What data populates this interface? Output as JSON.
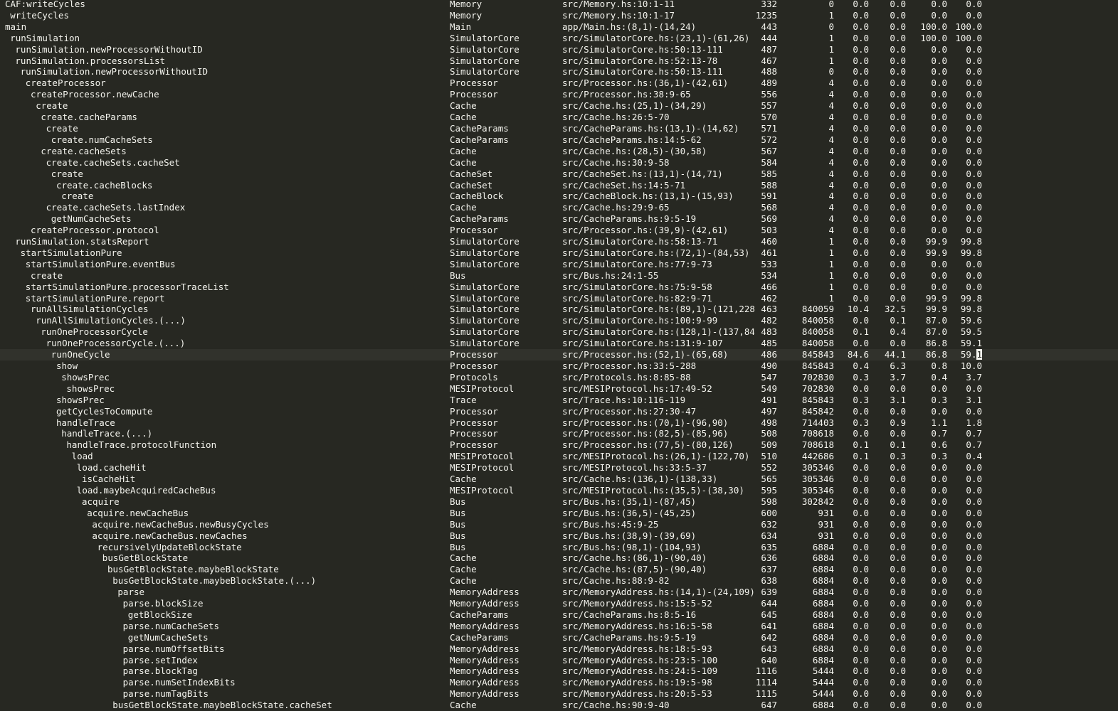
{
  "cursor_row": 31,
  "rows": [
    {
      "name": "CAF:writeCycles",
      "indent": 0,
      "module": "Memory",
      "src": "src/Memory.hs:10:1-11",
      "no": "332",
      "entries": "0",
      "ind_time": "0.0",
      "ind_alloc": "0.0",
      "inh_time": "0.0",
      "inh_alloc": "0.0"
    },
    {
      "name": "writeCycles",
      "indent": 1,
      "module": "Memory",
      "src": "src/Memory.hs:10:1-17",
      "no": "1235",
      "entries": "1",
      "ind_time": "0.0",
      "ind_alloc": "0.0",
      "inh_time": "0.0",
      "inh_alloc": "0.0"
    },
    {
      "name": "main",
      "indent": 0,
      "module": "Main",
      "src": "app/Main.hs:(8,1)-(14,24)",
      "no": "443",
      "entries": "0",
      "ind_time": "0.0",
      "ind_alloc": "0.0",
      "inh_time": "100.0",
      "inh_alloc": "100.0"
    },
    {
      "name": "runSimulation",
      "indent": 1,
      "module": "SimulatorCore",
      "src": "src/SimulatorCore.hs:(23,1)-(61,26)",
      "no": "444",
      "entries": "1",
      "ind_time": "0.0",
      "ind_alloc": "0.0",
      "inh_time": "100.0",
      "inh_alloc": "100.0"
    },
    {
      "name": "runSimulation.newProcessorWithoutID",
      "indent": 2,
      "module": "SimulatorCore",
      "src": "src/SimulatorCore.hs:50:13-111",
      "no": "487",
      "entries": "1",
      "ind_time": "0.0",
      "ind_alloc": "0.0",
      "inh_time": "0.0",
      "inh_alloc": "0.0"
    },
    {
      "name": "runSimulation.processorsList",
      "indent": 2,
      "module": "SimulatorCore",
      "src": "src/SimulatorCore.hs:52:13-78",
      "no": "467",
      "entries": "1",
      "ind_time": "0.0",
      "ind_alloc": "0.0",
      "inh_time": "0.0",
      "inh_alloc": "0.0"
    },
    {
      "name": "runSimulation.newProcessorWithoutID",
      "indent": 3,
      "module": "SimulatorCore",
      "src": "src/SimulatorCore.hs:50:13-111",
      "no": "488",
      "entries": "0",
      "ind_time": "0.0",
      "ind_alloc": "0.0",
      "inh_time": "0.0",
      "inh_alloc": "0.0"
    },
    {
      "name": "createProcessor",
      "indent": 4,
      "module": "Processor",
      "src": "src/Processor.hs:(36,1)-(42,61)",
      "no": "489",
      "entries": "4",
      "ind_time": "0.0",
      "ind_alloc": "0.0",
      "inh_time": "0.0",
      "inh_alloc": "0.0"
    },
    {
      "name": "createProcessor.newCache",
      "indent": 5,
      "module": "Processor",
      "src": "src/Processor.hs:38:9-65",
      "no": "556",
      "entries": "4",
      "ind_time": "0.0",
      "ind_alloc": "0.0",
      "inh_time": "0.0",
      "inh_alloc": "0.0"
    },
    {
      "name": "create",
      "indent": 6,
      "module": "Cache",
      "src": "src/Cache.hs:(25,1)-(34,29)",
      "no": "557",
      "entries": "4",
      "ind_time": "0.0",
      "ind_alloc": "0.0",
      "inh_time": "0.0",
      "inh_alloc": "0.0"
    },
    {
      "name": "create.cacheParams",
      "indent": 7,
      "module": "Cache",
      "src": "src/Cache.hs:26:5-70",
      "no": "570",
      "entries": "4",
      "ind_time": "0.0",
      "ind_alloc": "0.0",
      "inh_time": "0.0",
      "inh_alloc": "0.0"
    },
    {
      "name": "create",
      "indent": 8,
      "module": "CacheParams",
      "src": "src/CacheParams.hs:(13,1)-(14,62)",
      "no": "571",
      "entries": "4",
      "ind_time": "0.0",
      "ind_alloc": "0.0",
      "inh_time": "0.0",
      "inh_alloc": "0.0"
    },
    {
      "name": "create.numCacheSets",
      "indent": 9,
      "module": "CacheParams",
      "src": "src/CacheParams.hs:14:5-62",
      "no": "572",
      "entries": "4",
      "ind_time": "0.0",
      "ind_alloc": "0.0",
      "inh_time": "0.0",
      "inh_alloc": "0.0"
    },
    {
      "name": "create.cacheSets",
      "indent": 7,
      "module": "Cache",
      "src": "src/Cache.hs:(28,5)-(30,58)",
      "no": "567",
      "entries": "4",
      "ind_time": "0.0",
      "ind_alloc": "0.0",
      "inh_time": "0.0",
      "inh_alloc": "0.0"
    },
    {
      "name": "create.cacheSets.cacheSet",
      "indent": 8,
      "module": "Cache",
      "src": "src/Cache.hs:30:9-58",
      "no": "584",
      "entries": "4",
      "ind_time": "0.0",
      "ind_alloc": "0.0",
      "inh_time": "0.0",
      "inh_alloc": "0.0"
    },
    {
      "name": "create",
      "indent": 9,
      "module": "CacheSet",
      "src": "src/CacheSet.hs:(13,1)-(14,71)",
      "no": "585",
      "entries": "4",
      "ind_time": "0.0",
      "ind_alloc": "0.0",
      "inh_time": "0.0",
      "inh_alloc": "0.0"
    },
    {
      "name": "create.cacheBlocks",
      "indent": 10,
      "module": "CacheSet",
      "src": "src/CacheSet.hs:14:5-71",
      "no": "588",
      "entries": "4",
      "ind_time": "0.0",
      "ind_alloc": "0.0",
      "inh_time": "0.0",
      "inh_alloc": "0.0"
    },
    {
      "name": "create",
      "indent": 11,
      "module": "CacheBlock",
      "src": "src/CacheBlock.hs:(13,1)-(15,93)",
      "no": "591",
      "entries": "4",
      "ind_time": "0.0",
      "ind_alloc": "0.0",
      "inh_time": "0.0",
      "inh_alloc": "0.0"
    },
    {
      "name": "create.cacheSets.lastIndex",
      "indent": 8,
      "module": "Cache",
      "src": "src/Cache.hs:29:9-65",
      "no": "568",
      "entries": "4",
      "ind_time": "0.0",
      "ind_alloc": "0.0",
      "inh_time": "0.0",
      "inh_alloc": "0.0"
    },
    {
      "name": "getNumCacheSets",
      "indent": 9,
      "module": "CacheParams",
      "src": "src/CacheParams.hs:9:5-19",
      "no": "569",
      "entries": "4",
      "ind_time": "0.0",
      "ind_alloc": "0.0",
      "inh_time": "0.0",
      "inh_alloc": "0.0"
    },
    {
      "name": "createProcessor.protocol",
      "indent": 5,
      "module": "Processor",
      "src": "src/Processor.hs:(39,9)-(42,61)",
      "no": "503",
      "entries": "4",
      "ind_time": "0.0",
      "ind_alloc": "0.0",
      "inh_time": "0.0",
      "inh_alloc": "0.0"
    },
    {
      "name": "runSimulation.statsReport",
      "indent": 2,
      "module": "SimulatorCore",
      "src": "src/SimulatorCore.hs:58:13-71",
      "no": "460",
      "entries": "1",
      "ind_time": "0.0",
      "ind_alloc": "0.0",
      "inh_time": "99.9",
      "inh_alloc": "99.8"
    },
    {
      "name": "startSimulationPure",
      "indent": 3,
      "module": "SimulatorCore",
      "src": "src/SimulatorCore.hs:(72,1)-(84,53)",
      "no": "461",
      "entries": "1",
      "ind_time": "0.0",
      "ind_alloc": "0.0",
      "inh_time": "99.9",
      "inh_alloc": "99.8"
    },
    {
      "name": "startSimulationPure.eventBus",
      "indent": 4,
      "module": "SimulatorCore",
      "src": "src/SimulatorCore.hs:77:9-73",
      "no": "533",
      "entries": "1",
      "ind_time": "0.0",
      "ind_alloc": "0.0",
      "inh_time": "0.0",
      "inh_alloc": "0.0"
    },
    {
      "name": "create",
      "indent": 5,
      "module": "Bus",
      "src": "src/Bus.hs:24:1-55",
      "no": "534",
      "entries": "1",
      "ind_time": "0.0",
      "ind_alloc": "0.0",
      "inh_time": "0.0",
      "inh_alloc": "0.0"
    },
    {
      "name": "startSimulationPure.processorTraceList",
      "indent": 4,
      "module": "SimulatorCore",
      "src": "src/SimulatorCore.hs:75:9-58",
      "no": "466",
      "entries": "1",
      "ind_time": "0.0",
      "ind_alloc": "0.0",
      "inh_time": "0.0",
      "inh_alloc": "0.0"
    },
    {
      "name": "startSimulationPure.report",
      "indent": 4,
      "module": "SimulatorCore",
      "src": "src/SimulatorCore.hs:82:9-71",
      "no": "462",
      "entries": "1",
      "ind_time": "0.0",
      "ind_alloc": "0.0",
      "inh_time": "99.9",
      "inh_alloc": "99.8"
    },
    {
      "name": "runAllSimulationCycles",
      "indent": 5,
      "module": "SimulatorCore",
      "src": "src/SimulatorCore.hs:(89,1)-(121,228)",
      "no": "463",
      "entries": "840059",
      "ind_time": "10.4",
      "ind_alloc": "32.5",
      "inh_time": "99.9",
      "inh_alloc": "99.8"
    },
    {
      "name": "runAllSimulationCycles.(...)",
      "indent": 6,
      "module": "SimulatorCore",
      "src": "src/SimulatorCore.hs:100:9-99",
      "no": "482",
      "entries": "840058",
      "ind_time": "0.0",
      "ind_alloc": "0.1",
      "inh_time": "87.0",
      "inh_alloc": "59.6"
    },
    {
      "name": "runOneProcessorCycle",
      "indent": 7,
      "module": "SimulatorCore",
      "src": "src/SimulatorCore.hs:(128,1)-(137,84)",
      "no": "483",
      "entries": "840058",
      "ind_time": "0.1",
      "ind_alloc": "0.4",
      "inh_time": "87.0",
      "inh_alloc": "59.5"
    },
    {
      "name": "runOneProcessorCycle.(...)",
      "indent": 8,
      "module": "SimulatorCore",
      "src": "src/SimulatorCore.hs:131:9-107",
      "no": "485",
      "entries": "840058",
      "ind_time": "0.0",
      "ind_alloc": "0.0",
      "inh_time": "86.8",
      "inh_alloc": "59.1"
    },
    {
      "name": "runOneCycle",
      "indent": 9,
      "module": "Processor",
      "src": "src/Processor.hs:(52,1)-(65,68)",
      "no": "486",
      "entries": "845843",
      "ind_time": "84.6",
      "ind_alloc": "44.1",
      "inh_time": "86.8",
      "inh_alloc": "59.1"
    },
    {
      "name": "show",
      "indent": 10,
      "module": "Processor",
      "src": "src/Processor.hs:33:5-288",
      "no": "490",
      "entries": "845843",
      "ind_time": "0.4",
      "ind_alloc": "6.3",
      "inh_time": "0.8",
      "inh_alloc": "10.0"
    },
    {
      "name": "showsPrec",
      "indent": 11,
      "module": "Protocols",
      "src": "src/Protocols.hs:8:85-88",
      "no": "547",
      "entries": "702830",
      "ind_time": "0.3",
      "ind_alloc": "3.7",
      "inh_time": "0.4",
      "inh_alloc": "3.7"
    },
    {
      "name": "showsPrec",
      "indent": 12,
      "module": "MESIProtocol",
      "src": "src/MESIProtocol.hs:17:49-52",
      "no": "549",
      "entries": "702830",
      "ind_time": "0.0",
      "ind_alloc": "0.0",
      "inh_time": "0.0",
      "inh_alloc": "0.0"
    },
    {
      "name": "showsPrec",
      "indent": 10,
      "module": "Trace",
      "src": "src/Trace.hs:10:116-119",
      "no": "491",
      "entries": "845843",
      "ind_time": "0.3",
      "ind_alloc": "3.1",
      "inh_time": "0.3",
      "inh_alloc": "3.1"
    },
    {
      "name": "getCyclesToCompute",
      "indent": 10,
      "module": "Processor",
      "src": "src/Processor.hs:27:30-47",
      "no": "497",
      "entries": "845842",
      "ind_time": "0.0",
      "ind_alloc": "0.0",
      "inh_time": "0.0",
      "inh_alloc": "0.0"
    },
    {
      "name": "handleTrace",
      "indent": 10,
      "module": "Processor",
      "src": "src/Processor.hs:(70,1)-(96,90)",
      "no": "498",
      "entries": "714403",
      "ind_time": "0.3",
      "ind_alloc": "0.9",
      "inh_time": "1.1",
      "inh_alloc": "1.8"
    },
    {
      "name": "handleTrace.(...)",
      "indent": 11,
      "module": "Processor",
      "src": "src/Processor.hs:(82,5)-(85,96)",
      "no": "508",
      "entries": "708618",
      "ind_time": "0.0",
      "ind_alloc": "0.0",
      "inh_time": "0.7",
      "inh_alloc": "0.7"
    },
    {
      "name": "handleTrace.protocolFunction",
      "indent": 12,
      "module": "Processor",
      "src": "src/Processor.hs:(77,5)-(80,126)",
      "no": "509",
      "entries": "708618",
      "ind_time": "0.1",
      "ind_alloc": "0.1",
      "inh_time": "0.6",
      "inh_alloc": "0.7"
    },
    {
      "name": "load",
      "indent": 13,
      "module": "MESIProtocol",
      "src": "src/MESIProtocol.hs:(26,1)-(122,70)",
      "no": "510",
      "entries": "442686",
      "ind_time": "0.1",
      "ind_alloc": "0.3",
      "inh_time": "0.3",
      "inh_alloc": "0.4"
    },
    {
      "name": "load.cacheHit",
      "indent": 14,
      "module": "MESIProtocol",
      "src": "src/MESIProtocol.hs:33:5-37",
      "no": "552",
      "entries": "305346",
      "ind_time": "0.0",
      "ind_alloc": "0.0",
      "inh_time": "0.0",
      "inh_alloc": "0.0"
    },
    {
      "name": "isCacheHit",
      "indent": 15,
      "module": "Cache",
      "src": "src/Cache.hs:(136,1)-(138,33)",
      "no": "565",
      "entries": "305346",
      "ind_time": "0.0",
      "ind_alloc": "0.0",
      "inh_time": "0.0",
      "inh_alloc": "0.0"
    },
    {
      "name": "load.maybeAcquiredCacheBus",
      "indent": 14,
      "module": "MESIProtocol",
      "src": "src/MESIProtocol.hs:(35,5)-(38,30)",
      "no": "595",
      "entries": "305346",
      "ind_time": "0.0",
      "ind_alloc": "0.0",
      "inh_time": "0.0",
      "inh_alloc": "0.0"
    },
    {
      "name": "acquire",
      "indent": 15,
      "module": "Bus",
      "src": "src/Bus.hs:(35,1)-(87,45)",
      "no": "598",
      "entries": "302842",
      "ind_time": "0.0",
      "ind_alloc": "0.0",
      "inh_time": "0.0",
      "inh_alloc": "0.0"
    },
    {
      "name": "acquire.newCacheBus",
      "indent": 16,
      "module": "Bus",
      "src": "src/Bus.hs:(36,5)-(45,25)",
      "no": "600",
      "entries": "931",
      "ind_time": "0.0",
      "ind_alloc": "0.0",
      "inh_time": "0.0",
      "inh_alloc": "0.0"
    },
    {
      "name": "acquire.newCacheBus.newBusyCycles",
      "indent": 17,
      "module": "Bus",
      "src": "src/Bus.hs:45:9-25",
      "no": "632",
      "entries": "931",
      "ind_time": "0.0",
      "ind_alloc": "0.0",
      "inh_time": "0.0",
      "inh_alloc": "0.0"
    },
    {
      "name": "acquire.newCacheBus.newCaches",
      "indent": 17,
      "module": "Bus",
      "src": "src/Bus.hs:(38,9)-(39,69)",
      "no": "634",
      "entries": "931",
      "ind_time": "0.0",
      "ind_alloc": "0.0",
      "inh_time": "0.0",
      "inh_alloc": "0.0"
    },
    {
      "name": "recursivelyUpdateBlockState",
      "indent": 18,
      "module": "Bus",
      "src": "src/Bus.hs:(98,1)-(104,93)",
      "no": "635",
      "entries": "6884",
      "ind_time": "0.0",
      "ind_alloc": "0.0",
      "inh_time": "0.0",
      "inh_alloc": "0.0"
    },
    {
      "name": "busGetBlockState",
      "indent": 19,
      "module": "Cache",
      "src": "src/Cache.hs:(86,1)-(90,40)",
      "no": "636",
      "entries": "6884",
      "ind_time": "0.0",
      "ind_alloc": "0.0",
      "inh_time": "0.0",
      "inh_alloc": "0.0"
    },
    {
      "name": "busGetBlockState.maybeBlockState",
      "indent": 20,
      "module": "Cache",
      "src": "src/Cache.hs:(87,5)-(90,40)",
      "no": "637",
      "entries": "6884",
      "ind_time": "0.0",
      "ind_alloc": "0.0",
      "inh_time": "0.0",
      "inh_alloc": "0.0"
    },
    {
      "name": "busGetBlockState.maybeBlockState.(...)",
      "indent": 21,
      "module": "Cache",
      "src": "src/Cache.hs:88:9-82",
      "no": "638",
      "entries": "6884",
      "ind_time": "0.0",
      "ind_alloc": "0.0",
      "inh_time": "0.0",
      "inh_alloc": "0.0"
    },
    {
      "name": "parse",
      "indent": 22,
      "module": "MemoryAddress",
      "src": "src/MemoryAddress.hs:(14,1)-(24,109)",
      "no": "639",
      "entries": "6884",
      "ind_time": "0.0",
      "ind_alloc": "0.0",
      "inh_time": "0.0",
      "inh_alloc": "0.0"
    },
    {
      "name": "parse.blockSize",
      "indent": 23,
      "module": "MemoryAddress",
      "src": "src/MemoryAddress.hs:15:5-52",
      "no": "644",
      "entries": "6884",
      "ind_time": "0.0",
      "ind_alloc": "0.0",
      "inh_time": "0.0",
      "inh_alloc": "0.0"
    },
    {
      "name": "getBlockSize",
      "indent": 24,
      "module": "CacheParams",
      "src": "src/CacheParams.hs:8:5-16",
      "no": "645",
      "entries": "6884",
      "ind_time": "0.0",
      "ind_alloc": "0.0",
      "inh_time": "0.0",
      "inh_alloc": "0.0"
    },
    {
      "name": "parse.numCacheSets",
      "indent": 23,
      "module": "MemoryAddress",
      "src": "src/MemoryAddress.hs:16:5-58",
      "no": "641",
      "entries": "6884",
      "ind_time": "0.0",
      "ind_alloc": "0.0",
      "inh_time": "0.0",
      "inh_alloc": "0.0"
    },
    {
      "name": "getNumCacheSets",
      "indent": 24,
      "module": "CacheParams",
      "src": "src/CacheParams.hs:9:5-19",
      "no": "642",
      "entries": "6884",
      "ind_time": "0.0",
      "ind_alloc": "0.0",
      "inh_time": "0.0",
      "inh_alloc": "0.0"
    },
    {
      "name": "parse.numOffsetBits",
      "indent": 23,
      "module": "MemoryAddress",
      "src": "src/MemoryAddress.hs:18:5-93",
      "no": "643",
      "entries": "6884",
      "ind_time": "0.0",
      "ind_alloc": "0.0",
      "inh_time": "0.0",
      "inh_alloc": "0.0"
    },
    {
      "name": "parse.setIndex",
      "indent": 23,
      "module": "MemoryAddress",
      "src": "src/MemoryAddress.hs:23:5-100",
      "no": "640",
      "entries": "6884",
      "ind_time": "0.0",
      "ind_alloc": "0.0",
      "inh_time": "0.0",
      "inh_alloc": "0.0"
    },
    {
      "name": "parse.blockTag",
      "indent": 23,
      "module": "MemoryAddress",
      "src": "src/MemoryAddress.hs:24:5-109",
      "no": "1116",
      "entries": "5444",
      "ind_time": "0.0",
      "ind_alloc": "0.0",
      "inh_time": "0.0",
      "inh_alloc": "0.0"
    },
    {
      "name": "parse.numSetIndexBits",
      "indent": 23,
      "module": "MemoryAddress",
      "src": "src/MemoryAddress.hs:19:5-98",
      "no": "1114",
      "entries": "5444",
      "ind_time": "0.0",
      "ind_alloc": "0.0",
      "inh_time": "0.0",
      "inh_alloc": "0.0"
    },
    {
      "name": "parse.numTagBits",
      "indent": 23,
      "module": "MemoryAddress",
      "src": "src/MemoryAddress.hs:20:5-53",
      "no": "1115",
      "entries": "5444",
      "ind_time": "0.0",
      "ind_alloc": "0.0",
      "inh_time": "0.0",
      "inh_alloc": "0.0"
    },
    {
      "name": "busGetBlockState.maybeBlockState.cacheSet",
      "indent": 21,
      "module": "Cache",
      "src": "src/Cache.hs:90:9-40",
      "no": "647",
      "entries": "6884",
      "ind_time": "0.0",
      "ind_alloc": "0.0",
      "inh_time": "0.0",
      "inh_alloc": "0.0"
    }
  ]
}
